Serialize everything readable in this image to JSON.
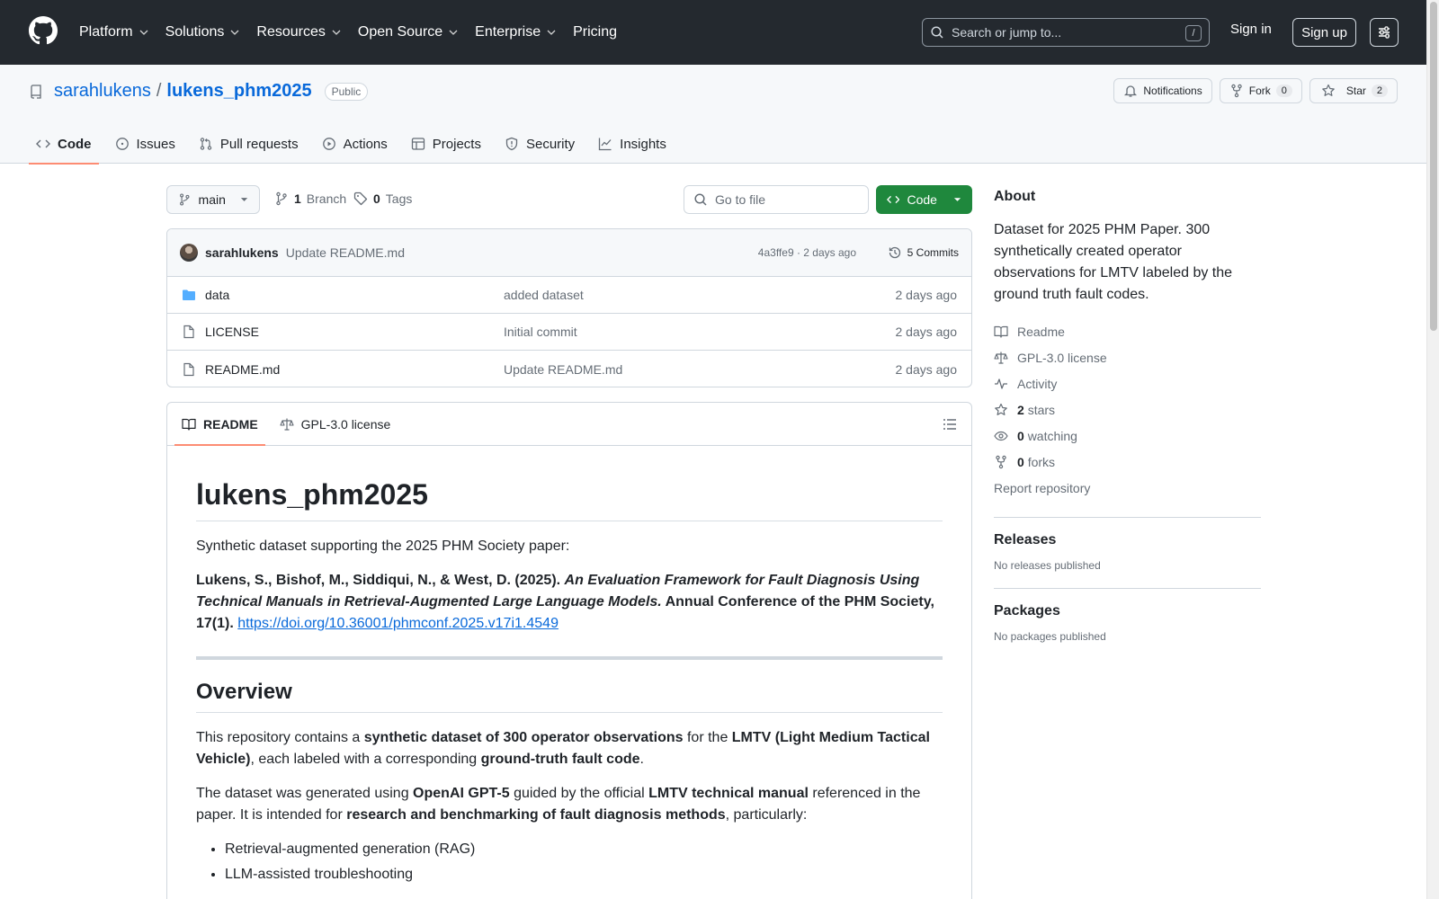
{
  "header": {
    "nav": [
      "Platform",
      "Solutions",
      "Resources",
      "Open Source",
      "Enterprise"
    ],
    "pricing": "Pricing",
    "search_placeholder": "Search or jump to...",
    "search_shortcut": "/",
    "sign_in": "Sign in",
    "sign_up": "Sign up"
  },
  "repo": {
    "owner": "sarahlukens",
    "separator": "/",
    "name": "lukens_phm2025",
    "visibility": "Public",
    "notifications_label": "Notifications",
    "fork_label": "Fork",
    "fork_count": "0",
    "star_label": "Star",
    "star_count": "2",
    "tabs": [
      "Code",
      "Issues",
      "Pull requests",
      "Actions",
      "Projects",
      "Security",
      "Insights"
    ]
  },
  "toolbar": {
    "branch": "main",
    "branch_count": "1",
    "branch_label": "Branch",
    "tag_count": "0",
    "tag_label": "Tags",
    "goto_placeholder": "Go to file",
    "code_label": "Code"
  },
  "commit": {
    "author": "sarahlukens",
    "message": "Update README.md",
    "meta": "4a3ffe9 · 2 days ago",
    "commits_label": "5 Commits"
  },
  "files": [
    {
      "name": "data",
      "commit": "added dataset",
      "age": "2 days ago",
      "type": "folder"
    },
    {
      "name": "LICENSE",
      "commit": "Initial commit",
      "age": "2 days ago",
      "type": "file"
    },
    {
      "name": "README.md",
      "commit": "Update README.md",
      "age": "2 days ago",
      "type": "file"
    }
  ],
  "readme": {
    "tabs": [
      "README",
      "GPL-3.0 license"
    ],
    "title": "lukens_phm2025",
    "intro": "Synthetic dataset supporting the 2025 PHM Society paper:",
    "cite_authors": "Lukens, S., Bishof, M., Siddiqui, N., & West, D. (2025). ",
    "cite_title": "An Evaluation Framework for Fault Diagnosis Using Technical Manuals in Retrieval-Augmented Large Language Models.",
    "cite_venue": " Annual Conference of the PHM Society, 17(1). ",
    "doi": "https://doi.org/10.36001/phmconf.2025.v17i1.4549",
    "overview_heading": "Overview",
    "p1_a": "This repository contains a ",
    "p1_b": "synthetic dataset of 300 operator observations",
    "p1_c": " for the ",
    "p1_d": "LMTV (Light Medium Tactical Vehicle)",
    "p1_e": ", each labeled with a corresponding ",
    "p1_f": "ground-truth fault code",
    "p1_g": ".",
    "p2_a": "The dataset was generated using ",
    "p2_b": "OpenAI GPT-5",
    "p2_c": " guided by the official ",
    "p2_d": "LMTV technical manual",
    "p2_e": " referenced in the paper. It is intended for ",
    "p2_f": "research and benchmarking of fault diagnosis methods",
    "p2_g": ", particularly:",
    "bullets": [
      "Retrieval-augmented generation (RAG)",
      "LLM-assisted troubleshooting"
    ]
  },
  "about": {
    "heading": "About",
    "description": "Dataset for 2025 PHM Paper. 300 synthetically created operator observations for LMTV labeled by the ground truth fault codes.",
    "readme": "Readme",
    "license": "GPL-3.0 license",
    "activity": "Activity",
    "stars_count": "2",
    "stars_label": "stars",
    "watching_count": "0",
    "watching_label": "watching",
    "forks_count": "0",
    "forks_label": "forks",
    "report": "Report repository",
    "releases_heading": "Releases",
    "releases_text": "No releases published",
    "packages_heading": "Packages",
    "packages_text": "No packages published"
  }
}
